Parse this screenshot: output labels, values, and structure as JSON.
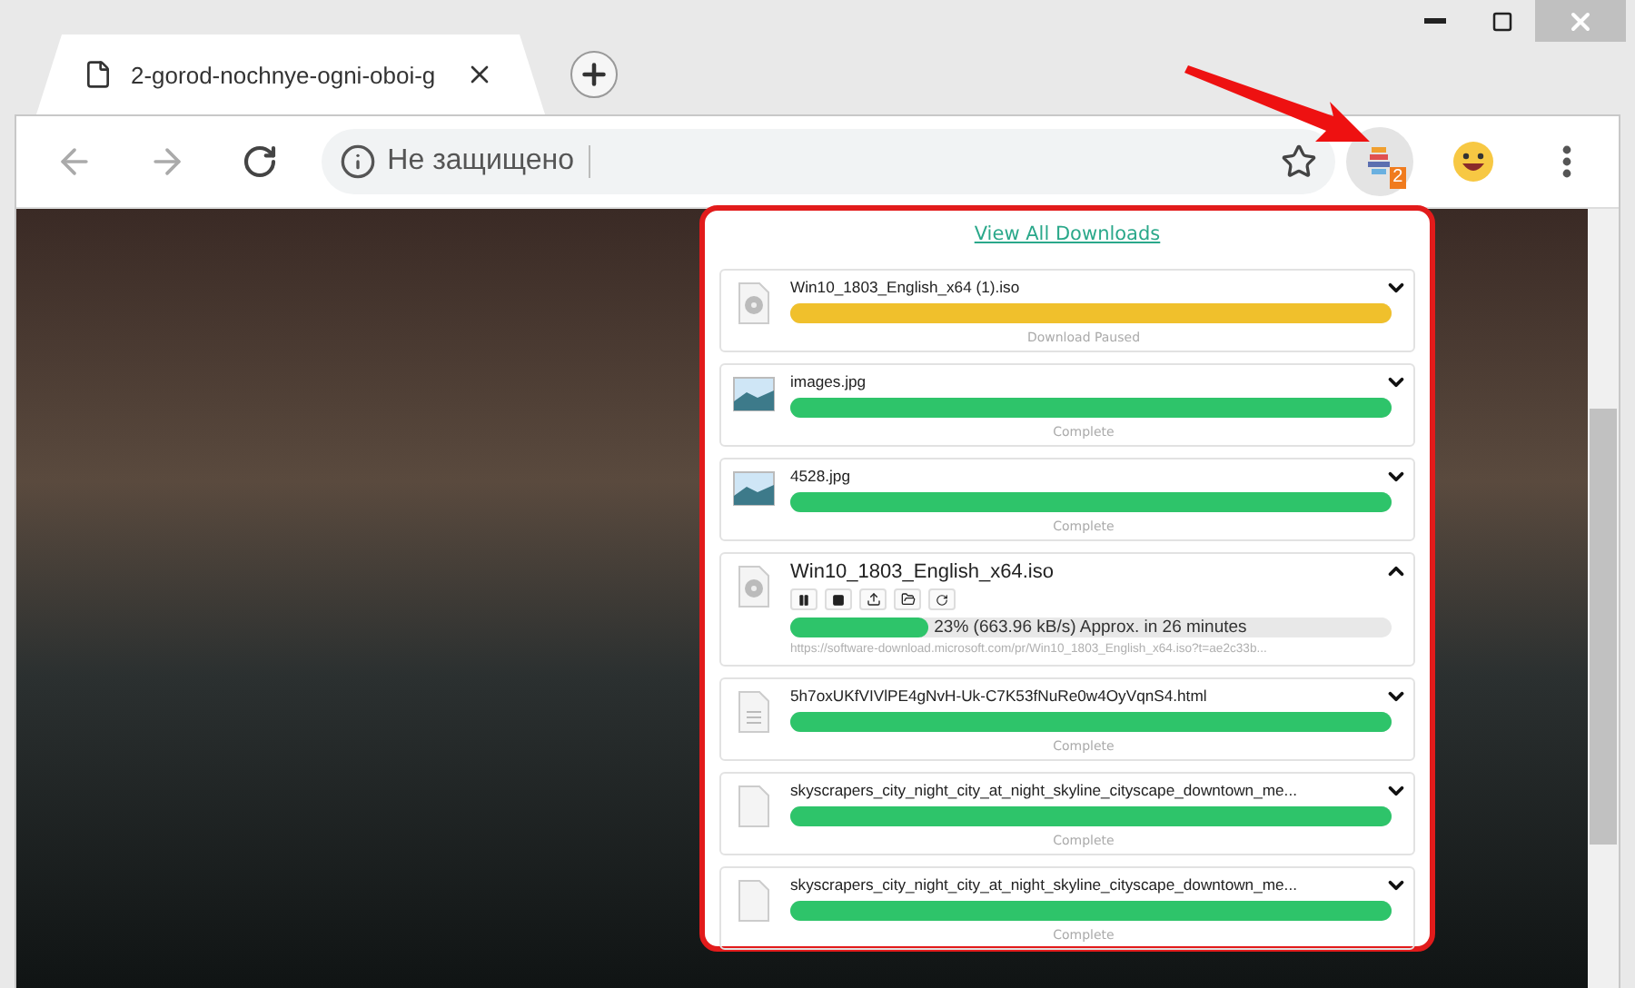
{
  "tab": {
    "title": "2-gorod-nochnye-ogni-oboi-g",
    "selected": true
  },
  "address_bar": {
    "security_label": "Не защищено"
  },
  "extension_badge": "2",
  "downloads_popup": {
    "link": "View All Downloads",
    "items": [
      {
        "name": "Win10_1803_English_x64 (1).iso",
        "kind": "disc",
        "level": 1,
        "color": "#f0c02c",
        "status": "Download Paused",
        "expanded": false
      },
      {
        "name": "images.jpg",
        "kind": "image",
        "level": 1,
        "color": "#2ec46a",
        "status": "Complete",
        "expanded": false
      },
      {
        "name": "4528.jpg",
        "kind": "image",
        "level": 1,
        "color": "#2ec46a",
        "status": "Complete",
        "expanded": false
      },
      {
        "name": "Win10_1803_English_x64.iso",
        "kind": "disc",
        "level": 0.23,
        "color": "#2ec46a",
        "progress_text": "23% (663.96 kB/s) Approx. in 26 minutes",
        "url": "https://software-download.microsoft.com/pr/Win10_1803_English_x64.iso?t=ae2c33b...",
        "expanded": true
      },
      {
        "name": "5h7oxUKfVIVlPE4gNvH-Uk-C7K53fNuRe0w4OyVqnS4.html",
        "kind": "text",
        "level": 1,
        "color": "#2ec46a",
        "status": "Complete",
        "expanded": false
      },
      {
        "name": "skyscrapers_city_night_city_at_night_skyline_cityscape_downtown_me...",
        "kind": "blank",
        "level": 1,
        "color": "#2ec46a",
        "status": "Complete",
        "expanded": false
      },
      {
        "name": "skyscrapers_city_night_city_at_night_skyline_cityscape_downtown_me...",
        "kind": "blank",
        "level": 1,
        "color": "#2ec46a",
        "status": "Complete",
        "expanded": false
      }
    ]
  }
}
